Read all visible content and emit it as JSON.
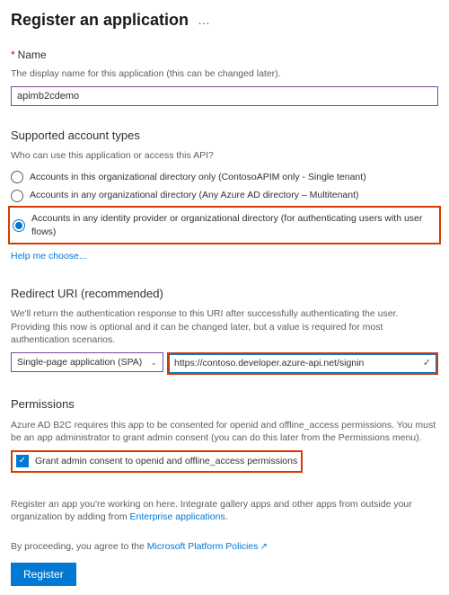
{
  "header": {
    "title": "Register an application"
  },
  "name_section": {
    "label": "Name",
    "desc": "The display name for this application (this can be changed later).",
    "value": "apimb2cdemo"
  },
  "account_types": {
    "title": "Supported account types",
    "desc": "Who can use this application or access this API?",
    "options": [
      "Accounts in this organizational directory only (ContosoAPIM only - Single tenant)",
      "Accounts in any organizational directory (Any Azure AD directory – Multitenant)",
      "Accounts in any identity provider or organizational directory (for authenticating users with user flows)"
    ],
    "help_link": "Help me choose..."
  },
  "redirect": {
    "title": "Redirect URI (recommended)",
    "desc": "We'll return the authentication response to this URI after successfully authenticating the user. Providing this now is optional and it can be changed later, but a value is required for most authentication scenarios.",
    "platform": "Single-page application (SPA)",
    "uri": "https://contoso.developer.azure-api.net/signin"
  },
  "permissions": {
    "title": "Permissions",
    "desc": "Azure AD B2C requires this app to be consented for openid and offline_access permissions. You must be an app administrator to grant admin consent (you can do this later from the Permissions menu).",
    "checkbox_label": "Grant admin consent to openid and offline_access permissions"
  },
  "footer": {
    "note_prefix": "Register an app you're working on here. Integrate gallery apps and other apps from outside your organization by adding from ",
    "note_link": "Enterprise applications",
    "note_suffix": ".",
    "agree_prefix": "By proceeding, you agree to the ",
    "agree_link": "Microsoft Platform Policies",
    "register": "Register"
  }
}
